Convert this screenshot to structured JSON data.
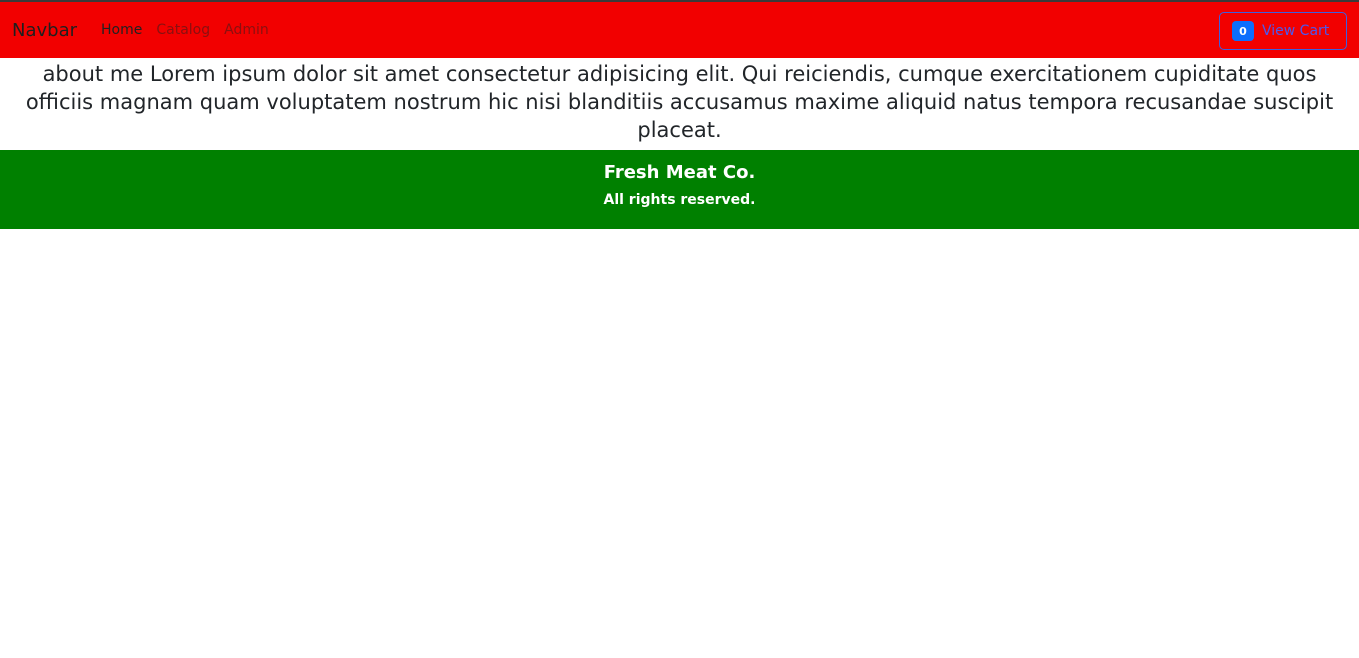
{
  "navbar": {
    "brand": "Navbar",
    "links": [
      {
        "label": "Home",
        "active": true
      },
      {
        "label": "Catalog",
        "active": false
      },
      {
        "label": "Admin",
        "active": false
      }
    ],
    "cart": {
      "count": "0",
      "label": "View Cart"
    }
  },
  "main": {
    "about_text": "about me Lorem ipsum dolor sit amet consectetur adipisicing elit. Qui reiciendis, cumque exercitationem cupiditate quos officiis magnam quam voluptatem nostrum hic nisi blanditiis accusamus maxime aliquid natus tempora recusandae suscipit placeat."
  },
  "footer": {
    "title": "Fresh Meat Co.",
    "subtitle": "All rights reserved."
  },
  "colors": {
    "navbar_bg": "#f20000",
    "footer_bg": "#008000",
    "badge_bg": "#0d6efd",
    "cart_text": "#4a59f0"
  }
}
